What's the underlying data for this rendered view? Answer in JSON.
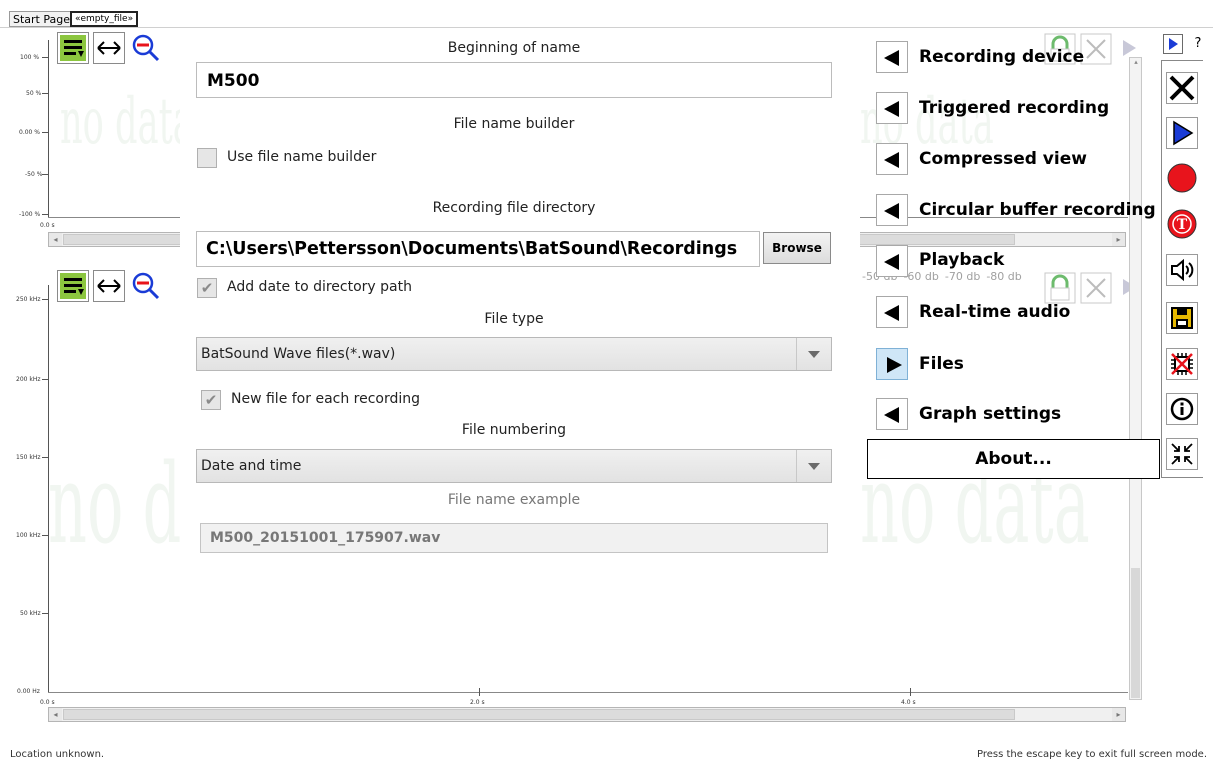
{
  "tabs": [
    {
      "label": "Start Page",
      "active": false
    },
    {
      "label": "«empty_file»",
      "active": true
    }
  ],
  "top_plot": {
    "y_ticks": [
      "100 %",
      "50 %",
      "0.00 %",
      "-50 %",
      "-100 %"
    ],
    "x_start": "0.0 s",
    "watermark": "no data"
  },
  "bottom_plot": {
    "y_ticks": [
      "250 kHz",
      "200 kHz",
      "150 kHz",
      "100 kHz",
      "50 kHz",
      "0.00 Hz"
    ],
    "x_ticks": [
      "0.0 s",
      "2.0 s",
      "4.0 s"
    ],
    "watermark": "no data"
  },
  "db_ticks": [
    "-50 db",
    "-60 db",
    "-70 db",
    "-80 db"
  ],
  "settings": {
    "beginning_of_name_label": "Beginning of name",
    "beginning_of_name_value": "M500",
    "file_name_builder_label": "File name builder",
    "use_file_name_builder_label": "Use file name builder",
    "use_file_name_builder_checked": false,
    "recording_dir_label": "Recording file directory",
    "recording_dir_value": "C:\\Users\\Pettersson\\Documents\\BatSound\\Recordings",
    "browse_label": "Browse",
    "add_date_label": "Add date to directory path",
    "add_date_checked": true,
    "file_type_label": "File type",
    "file_type_value": "BatSound Wave files(*.wav)",
    "new_file_label": "New file for each recording",
    "new_file_checked": true,
    "file_numbering_label": "File numbering",
    "file_numbering_value": "Date and time",
    "file_name_example_label": "File name example",
    "file_name_example_value": "M500_20151001_175907.wav"
  },
  "menu": {
    "items": [
      {
        "label": "Recording device",
        "expanded": false
      },
      {
        "label": "Triggered recording",
        "expanded": false
      },
      {
        "label": "Compressed view",
        "expanded": false
      },
      {
        "label": "Circular buffer recording",
        "expanded": false
      },
      {
        "label": "Playback",
        "expanded": false
      },
      {
        "label": "Real-time audio",
        "expanded": false
      },
      {
        "label": "Files",
        "expanded": true
      },
      {
        "label": "Graph settings",
        "expanded": false
      }
    ],
    "about_label": "About..."
  },
  "top_right": {
    "play": "▶",
    "help": "?"
  },
  "status": {
    "left": "Location unknown.",
    "right": "Press the escape key to exit full screen mode."
  },
  "colors": {
    "accent": "#cfe6f7",
    "record_red": "#e8141c",
    "play_blue": "#1a3bd6"
  }
}
